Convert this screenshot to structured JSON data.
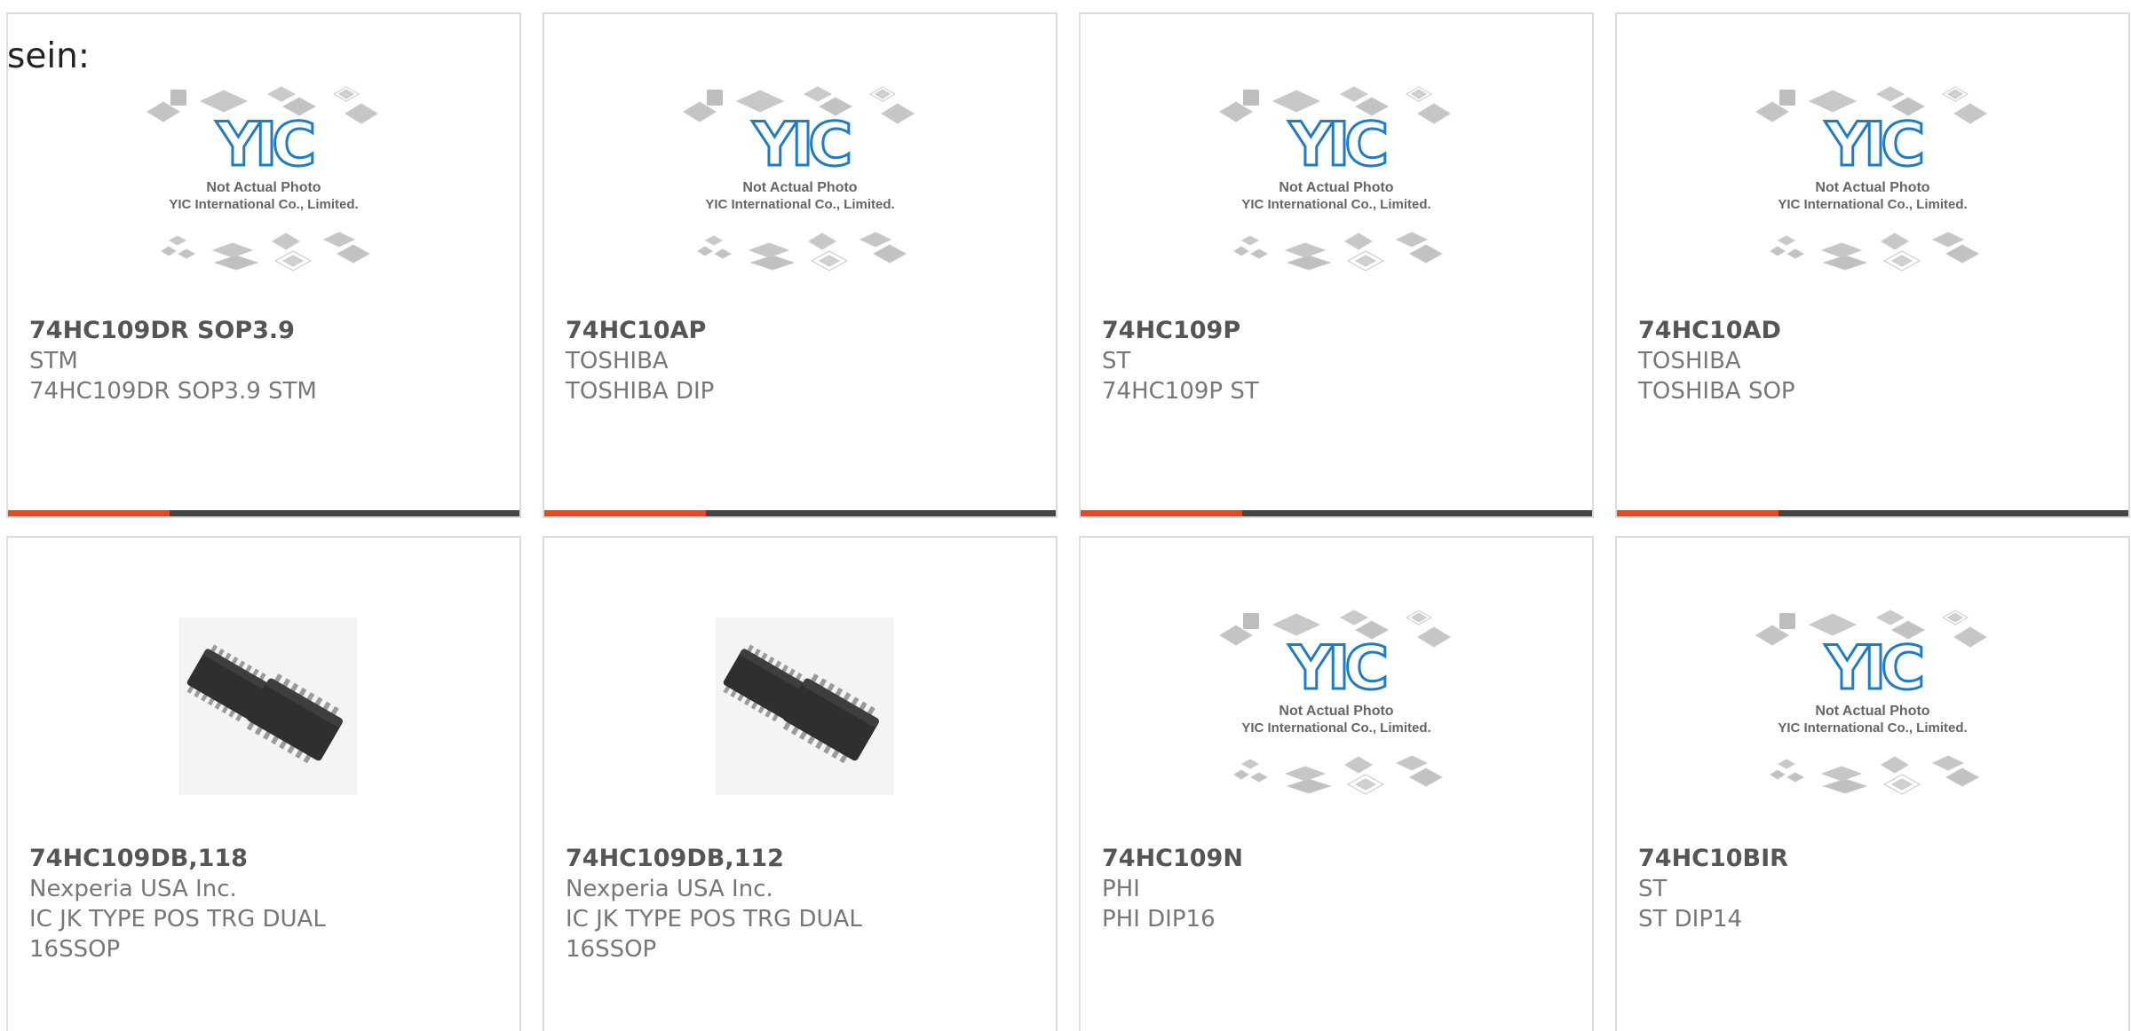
{
  "intro_text": "sein:",
  "colors": {
    "accent": "#e8481c",
    "bar": "#444444",
    "card_border": "#dcdcdc",
    "logo_blue": "#1e7bc4"
  },
  "placeholder": {
    "line1": "Not Actual Photo",
    "line2": "YIC International Co., Limited.",
    "logo_text": "YIC"
  },
  "products": [
    {
      "part": "74HC109DR SOP3.9",
      "maker": "STM",
      "desc": [
        "74HC109DR SOP3.9 STM"
      ],
      "image": "placeholder-logo",
      "accent_bar": true
    },
    {
      "part": "74HC10AP",
      "maker": "TOSHIBA",
      "desc": [
        "TOSHIBA DIP"
      ],
      "image": "placeholder-logo",
      "accent_bar": true
    },
    {
      "part": "74HC109P",
      "maker": "ST",
      "desc": [
        "74HC109P ST"
      ],
      "image": "placeholder-logo",
      "accent_bar": true
    },
    {
      "part": "74HC10AD",
      "maker": "TOSHIBA",
      "desc": [
        "TOSHIBA SOP"
      ],
      "image": "placeholder-logo",
      "accent_bar": true
    },
    {
      "part": "74HC109DB,118",
      "maker": "Nexperia USA Inc.",
      "desc": [
        "IC JK TYPE POS TRG DUAL",
        "16SSOP"
      ],
      "image": "ssop-chip-photo",
      "accent_bar": false
    },
    {
      "part": "74HC109DB,112",
      "maker": "Nexperia USA Inc.",
      "desc": [
        "IC JK TYPE POS TRG DUAL",
        "16SSOP"
      ],
      "image": "ssop-chip-photo",
      "accent_bar": false
    },
    {
      "part": "74HC109N",
      "maker": "PHI",
      "desc": [
        "PHI DIP16"
      ],
      "image": "placeholder-logo",
      "accent_bar": false
    },
    {
      "part": "74HC10BIR",
      "maker": "ST",
      "desc": [
        "ST DIP14"
      ],
      "image": "placeholder-logo",
      "accent_bar": false
    }
  ]
}
